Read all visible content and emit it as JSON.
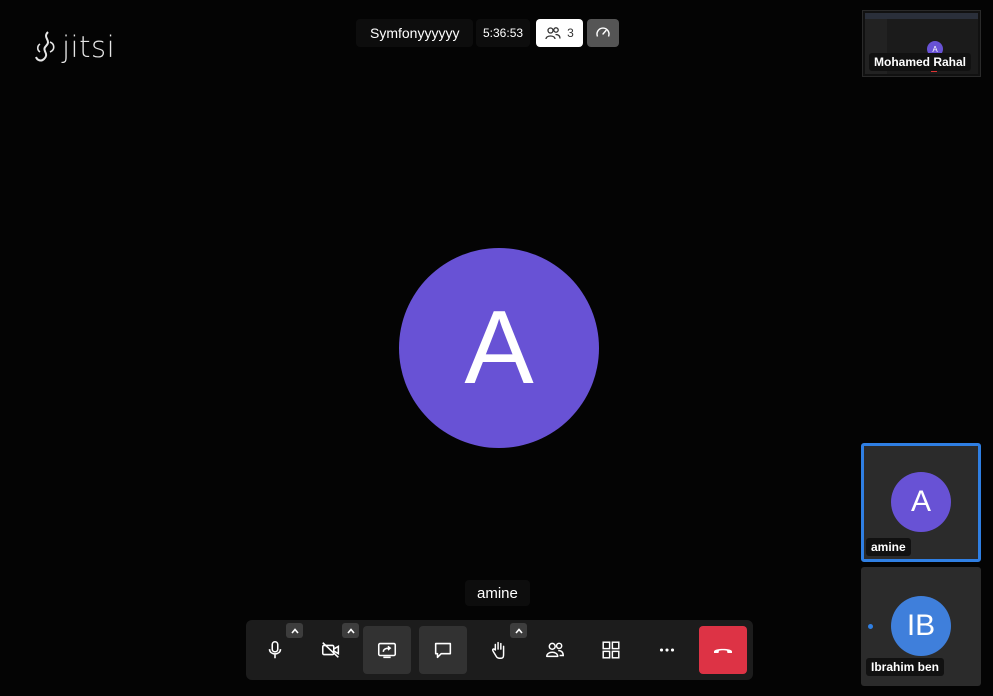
{
  "logo": {
    "text": "jitsi"
  },
  "header": {
    "meeting_title": "Symfonyyyyyy",
    "timer": "5:36:53",
    "participant_count": "3"
  },
  "main": {
    "avatar_initial": "A",
    "avatar_color": "#6852d5",
    "speaker_name": "amine"
  },
  "toolbar": {
    "buttons": [
      {
        "icon": "microphone-icon",
        "has_menu": true
      },
      {
        "icon": "camera-off-icon",
        "has_menu": true
      },
      {
        "icon": "share-screen-icon",
        "active": true
      },
      {
        "icon": "chat-icon",
        "active": true
      },
      {
        "icon": "raise-hand-icon",
        "has_menu": true
      },
      {
        "icon": "participants-icon"
      },
      {
        "icon": "tile-view-icon"
      },
      {
        "icon": "more-options-icon"
      },
      {
        "icon": "hangup-icon",
        "color": "#dd3345"
      }
    ]
  },
  "filmstrip": {
    "screen_share": {
      "name": "Mohamed Rahal",
      "mini_initial": "A"
    },
    "tiles": [
      {
        "name": "amine",
        "initial": "A",
        "color": "#6852d5",
        "dominant": true
      },
      {
        "name": "Ibrahim ben",
        "initial": "IB",
        "color": "#3f7fdb"
      }
    ]
  },
  "colors": {
    "accent": "#2f7fe3",
    "hangup": "#dd3345",
    "background": "#040404"
  }
}
